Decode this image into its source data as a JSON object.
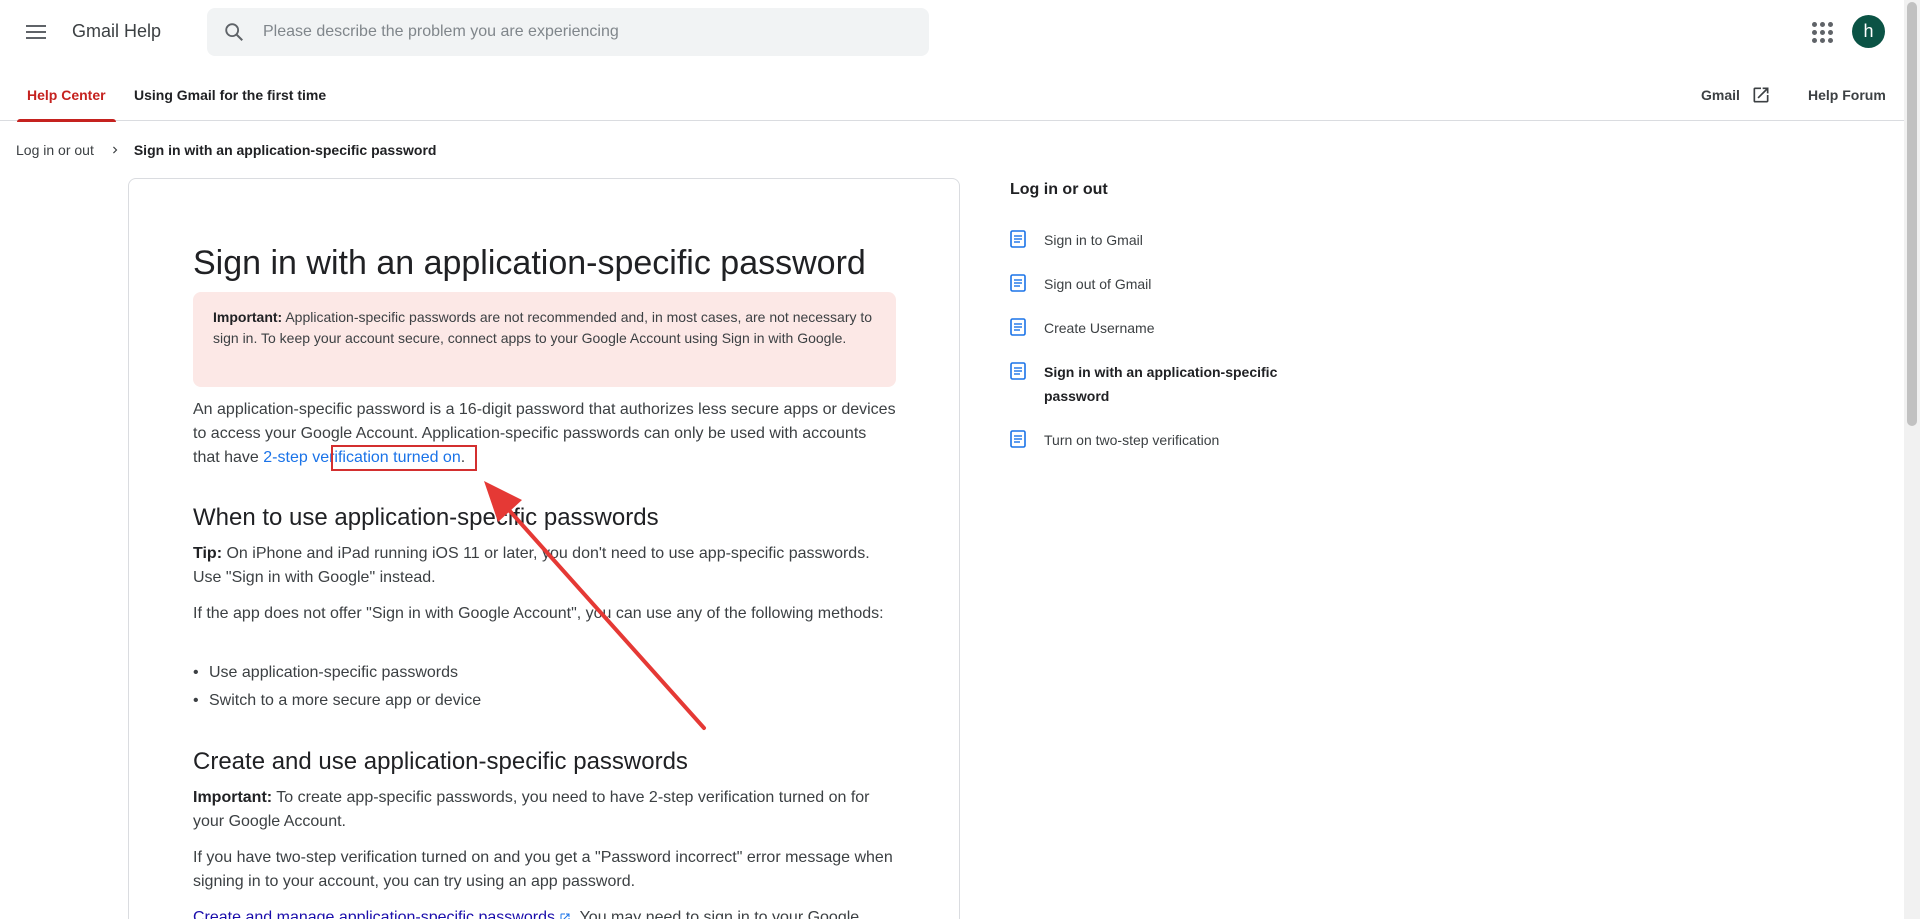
{
  "header": {
    "brand": "Gmail Help",
    "search_placeholder": "Please describe the problem you are experiencing",
    "avatar_letter": "h"
  },
  "nav": {
    "tabs": [
      {
        "label": "Help Center",
        "active": true
      },
      {
        "label": "Using Gmail for the first time",
        "active": false
      }
    ],
    "gmail_link": "Gmail",
    "forum_link": "Help Forum"
  },
  "breadcrumb": {
    "parent": "Log in or out",
    "current": "Sign in with an application-specific password"
  },
  "article": {
    "title": "Sign in with an application-specific password",
    "callout": {
      "label": "Important:",
      "text": " Application-specific passwords are not recommended and, in most cases, are not necessary to sign in. To keep your account secure, connect apps to your Google Account using Sign in with Google."
    },
    "intro": {
      "text_before": "An application-specific password is a 16-digit password that authorizes less secure apps or devices to access your Google Account. Application-specific passwords can only be used with accounts that have ",
      "link": "2-step verification turned on",
      "text_after": "."
    },
    "section1": {
      "heading": "When to use application-specific passwords",
      "tip_label": "Tip:",
      "tip_text": " On iPhone and iPad running iOS 11 or later, you don't need to use app-specific passwords. Use \"Sign in with Google\" instead.",
      "para": "If the app does not offer \"Sign in with Google Account\", you can use any of the following methods:",
      "bullets": [
        "Use application-specific passwords",
        "Switch to a more secure app or device"
      ]
    },
    "section2": {
      "heading": "Create and use application-specific passwords",
      "important_label": "Important:",
      "important_text": " To create app-specific passwords, you need to have 2-step verification turned on for your Google Account.",
      "para": "If you have two-step verification turned on and you get a \"Password incorrect\" error message when signing in to your account, you can try using an app password.",
      "link": "Create and manage application-specific passwords",
      "after_link": ". You may need to sign in to your Google"
    }
  },
  "sidebar": {
    "title": "Log in or out",
    "items": [
      {
        "label": "Sign in to Gmail",
        "current": false
      },
      {
        "label": "Sign out of Gmail",
        "current": false
      },
      {
        "label": "Create Username",
        "current": false
      },
      {
        "label": "Sign in with an application-specific password",
        "current": true
      },
      {
        "label": "Turn on two-step verification",
        "current": false
      }
    ]
  },
  "colors": {
    "accent_red": "#c5221f",
    "link_blue": "#1a73e8",
    "callout_bg": "#fce8e6",
    "annotation_red": "#d32f2f",
    "avatar_bg": "#0b5345"
  }
}
